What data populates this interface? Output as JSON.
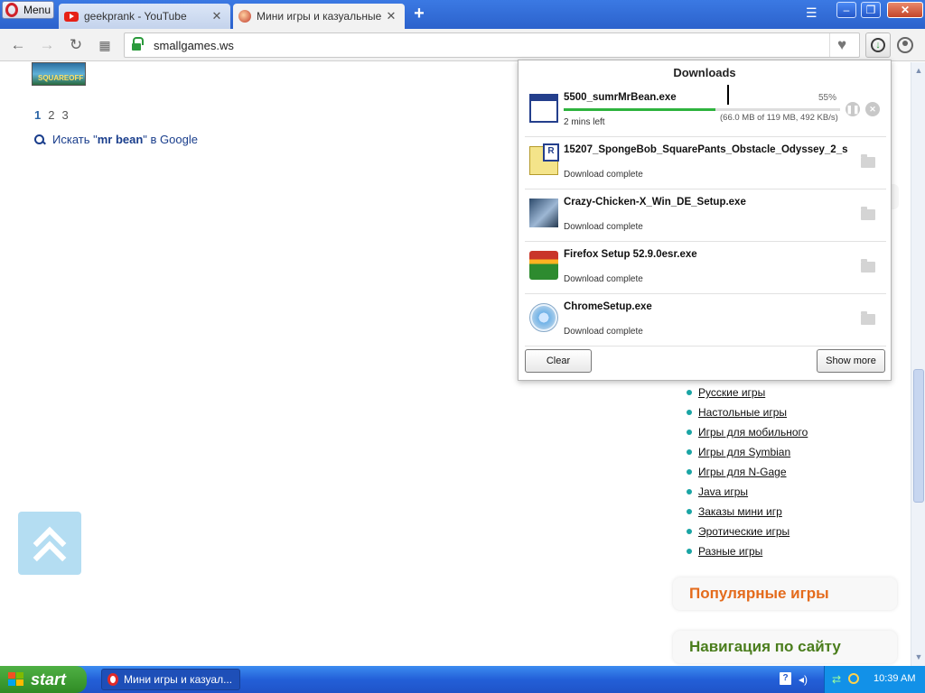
{
  "browser": {
    "menu_label": "Menu",
    "tabs": [
      {
        "title": "geekprank - YouTube",
        "close": "✕"
      },
      {
        "title": "Мини игры и казуальные иг",
        "close": "✕"
      }
    ],
    "new_tab": "+",
    "url": "smallgames.ws"
  },
  "page": {
    "pager": {
      "pages": [
        "1",
        "2",
        "3"
      ],
      "current": "1"
    },
    "google_search": {
      "prefix": "Искать \"",
      "query": "mr bean",
      "suffix": "\" в Google"
    },
    "categories": [
      "Русские игры",
      "Настольные игры",
      "Игры для мобильного",
      "Игры для Symbian",
      "Игры для N-Gage",
      "Java игры",
      "Заказы мини игр",
      "Эротические игры",
      "Разные игры"
    ],
    "sections": {
      "popular": "Популярные игры",
      "navigation": "Навигация по сайту"
    }
  },
  "downloads": {
    "title": "Downloads",
    "active": {
      "name": "5500_sumrMrBean.exe",
      "percent": "55%",
      "progress": 0.55,
      "time_left": "2 mins left",
      "detail": "(66.0 MB of 119 MB, 492 KB/s)"
    },
    "completed": [
      {
        "name": "15207_SpongeBob_SquarePants_Obstacle_Odyssey_2_s",
        "status": "Download complete",
        "icon": "registry-file-icon"
      },
      {
        "name": "Crazy-Chicken-X_Win_DE_Setup.exe",
        "status": "Download complete",
        "icon": "crazy-chicken-icon"
      },
      {
        "name": "Firefox Setup 52.9.0esr.exe",
        "status": "Download complete",
        "icon": "firefox-installer-icon"
      },
      {
        "name": "ChromeSetup.exe",
        "status": "Download complete",
        "icon": "chrome-installer-icon"
      }
    ],
    "clear_label": "Clear",
    "show_more_label": "Show more"
  },
  "taskbar": {
    "start_label": "start",
    "task_title": "Мини игры и казуал...",
    "clock": "10:39 AM",
    "help": "?"
  }
}
